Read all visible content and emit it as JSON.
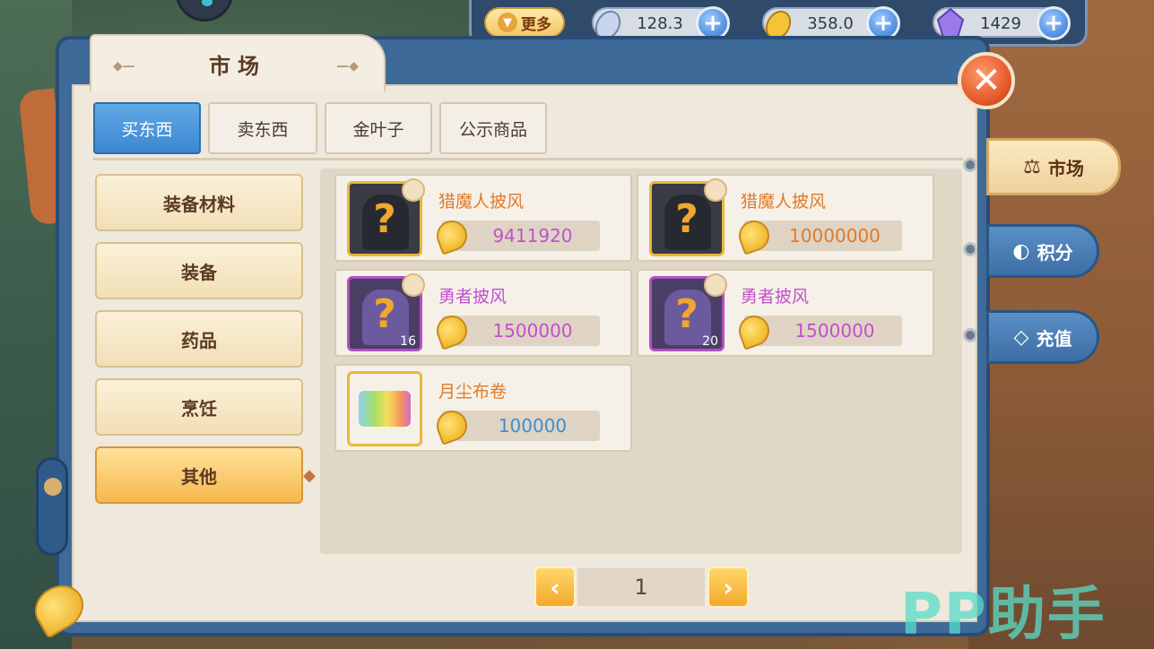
{
  "topbar": {
    "more_label": "更多",
    "more_icon": "chevron-down-icon",
    "currencies": [
      {
        "icon": "silver-leaf-icon",
        "value": "128.3万",
        "color": "#9fb6d8"
      },
      {
        "icon": "gold-leaf-icon",
        "value": "358.0万",
        "color": "#f0b82a"
      },
      {
        "icon": "crystal-icon",
        "value": "1429",
        "color": "#8a6ad8"
      }
    ]
  },
  "window": {
    "title": "市场",
    "close_icon": "close-icon"
  },
  "tabs": [
    {
      "label": "买东西",
      "active": true
    },
    {
      "label": "卖东西",
      "active": false
    },
    {
      "label": "金叶子",
      "active": false
    },
    {
      "label": "公示商品",
      "active": false
    }
  ],
  "categories": [
    {
      "label": "装备材料",
      "active": false
    },
    {
      "label": "装备",
      "active": false
    },
    {
      "label": "药品",
      "active": false
    },
    {
      "label": "烹饪",
      "active": false
    },
    {
      "label": "其他",
      "active": true
    }
  ],
  "items": [
    {
      "name": "猎魔人披风",
      "price": "9411920",
      "name_color": "#e07a2a",
      "price_color": "#c24fd0",
      "frame": "gold",
      "count": ""
    },
    {
      "name": "猎魔人披风",
      "price": "10000000",
      "name_color": "#e07a2a",
      "price_color": "#e07a2a",
      "frame": "gold",
      "count": ""
    },
    {
      "name": "勇者披风",
      "price": "1500000",
      "name_color": "#c24fd0",
      "price_color": "#c24fd0",
      "frame": "purple",
      "count": "16"
    },
    {
      "name": "勇者披风",
      "price": "1500000",
      "name_color": "#c24fd0",
      "price_color": "#c24fd0",
      "frame": "purple",
      "count": "20"
    },
    {
      "name": "月尘布卷",
      "price": "100000",
      "name_color": "#e07a2a",
      "price_color": "#3c8ed0",
      "frame": "gold",
      "count": ""
    }
  ],
  "pager": {
    "page": "1"
  },
  "side_tabs": [
    {
      "label": "市场",
      "icon": "scale-icon",
      "active": true
    },
    {
      "label": "积分",
      "icon": "points-icon",
      "active": false
    },
    {
      "label": "充值",
      "icon": "diamond-icon",
      "active": false
    }
  ],
  "watermark": "PP助手"
}
